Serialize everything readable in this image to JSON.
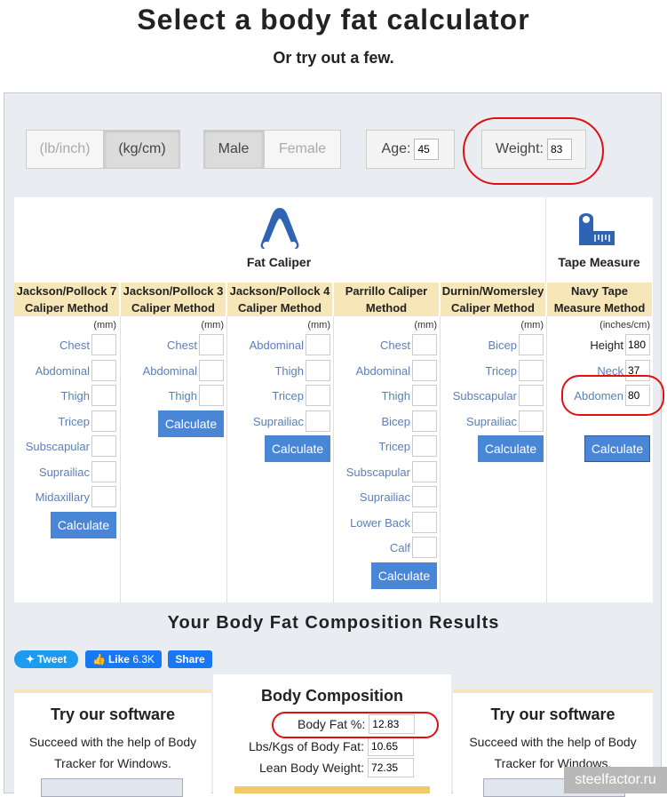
{
  "header": {
    "title": "Select a body fat calculator",
    "subtitle": "Or try out a few."
  },
  "units": {
    "imperial": "(lb/inch)",
    "metric": "(kg/cm)",
    "selected": "metric"
  },
  "gender": {
    "male": "Male",
    "female": "Female",
    "selected": "male"
  },
  "age": {
    "label": "Age:",
    "value": "45"
  },
  "weight": {
    "label": "Weight:",
    "value": "83"
  },
  "groups": {
    "caliper": "Fat Caliper",
    "tape": "Tape Measure"
  },
  "methods": [
    {
      "name": "Jackson/Pollock 7 Caliper Method",
      "unit": "(mm)",
      "fields": [
        "Chest",
        "Abdominal",
        "Thigh",
        "Tricep",
        "Subscapular",
        "Suprailiac",
        "Midaxillary"
      ],
      "button": "Calculate"
    },
    {
      "name": "Jackson/Pollock 3 Caliper Method",
      "unit": "(mm)",
      "fields": [
        "Chest",
        "Abdominal",
        "Thigh"
      ],
      "button": "Calculate"
    },
    {
      "name": "Jackson/Pollock 4 Caliper Method",
      "unit": "(mm)",
      "fields": [
        "Abdominal",
        "Thigh",
        "Tricep",
        "Suprailiac"
      ],
      "button": "Calculate"
    },
    {
      "name": "Parrillo Caliper Method",
      "unit": "(mm)",
      "fields": [
        "Chest",
        "Abdominal",
        "Thigh",
        "Bicep",
        "Tricep",
        "Subscapular",
        "Suprailiac",
        "Lower Back",
        "Calf"
      ],
      "button": "Calculate"
    },
    {
      "name": "Durnin/Womersley Caliper Method",
      "unit": "(mm)",
      "fields": [
        "Bicep",
        "Tricep",
        "Subscapular",
        "Suprailiac"
      ],
      "button": "Calculate"
    },
    {
      "name": "Navy Tape Measure Method",
      "unit": "(inches/cm)",
      "fields": [
        "Height",
        "Neck",
        "Abdomen"
      ],
      "values": [
        "180",
        "37",
        "80"
      ],
      "button": "Calculate"
    }
  ],
  "results": {
    "title": "Your Body Fat Composition Results"
  },
  "social": {
    "tweet": "Tweet",
    "like": "Like",
    "like_count": "6.3K",
    "share": "Share"
  },
  "promo": {
    "title": "Try our software",
    "text_line1": "Succeed with the help of Body",
    "text_line2": "Tracker for Windows."
  },
  "composition": {
    "title": "Body Composition",
    "body_fat_label": "Body Fat %:",
    "body_fat_value": "12.83",
    "fat_mass_label": "Lbs/Kgs of Body Fat:",
    "fat_mass_value": "10.65",
    "lean_label": "Lean Body Weight:",
    "lean_value": "72.35"
  },
  "watermark": "steelfactor.ru",
  "colors": {
    "accent": "#4a86d6",
    "header_bg": "#f7e6b8",
    "annotation": "#e01010"
  }
}
